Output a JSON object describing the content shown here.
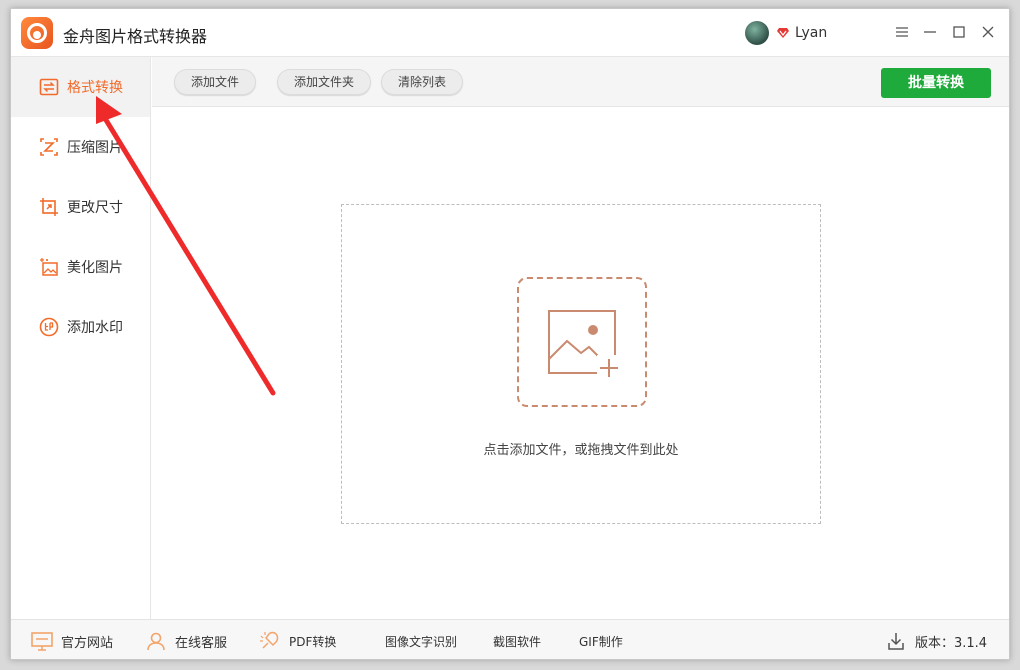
{
  "app": {
    "title": "金舟图片格式转换器",
    "user_name": "Lyan",
    "accent_color": "#f26b2a",
    "primary_button_color": "#1faa3c"
  },
  "sidebar": {
    "items": [
      {
        "label": "格式转换",
        "icon": "swap-icon",
        "active": true
      },
      {
        "label": "压缩图片",
        "icon": "compress-icon",
        "active": false
      },
      {
        "label": "更改尺寸",
        "icon": "resize-icon",
        "active": false
      },
      {
        "label": "美化图片",
        "icon": "beautify-icon",
        "active": false
      },
      {
        "label": "添加水印",
        "icon": "watermark-icon",
        "active": false
      }
    ]
  },
  "toolbar": {
    "add_file": "添加文件",
    "add_folder": "添加文件夹",
    "clear_list": "清除列表",
    "batch_convert": "批量转换"
  },
  "dropzone": {
    "hint": "点击添加文件，或拖拽文件到此处"
  },
  "statusbar": {
    "website": "官方网站",
    "support": "在线客服",
    "pdf": "PDF转换",
    "ocr": "图像文字识别",
    "screenshot": "截图软件",
    "gif": "GIF制作",
    "version": "版本：3.1.4"
  }
}
